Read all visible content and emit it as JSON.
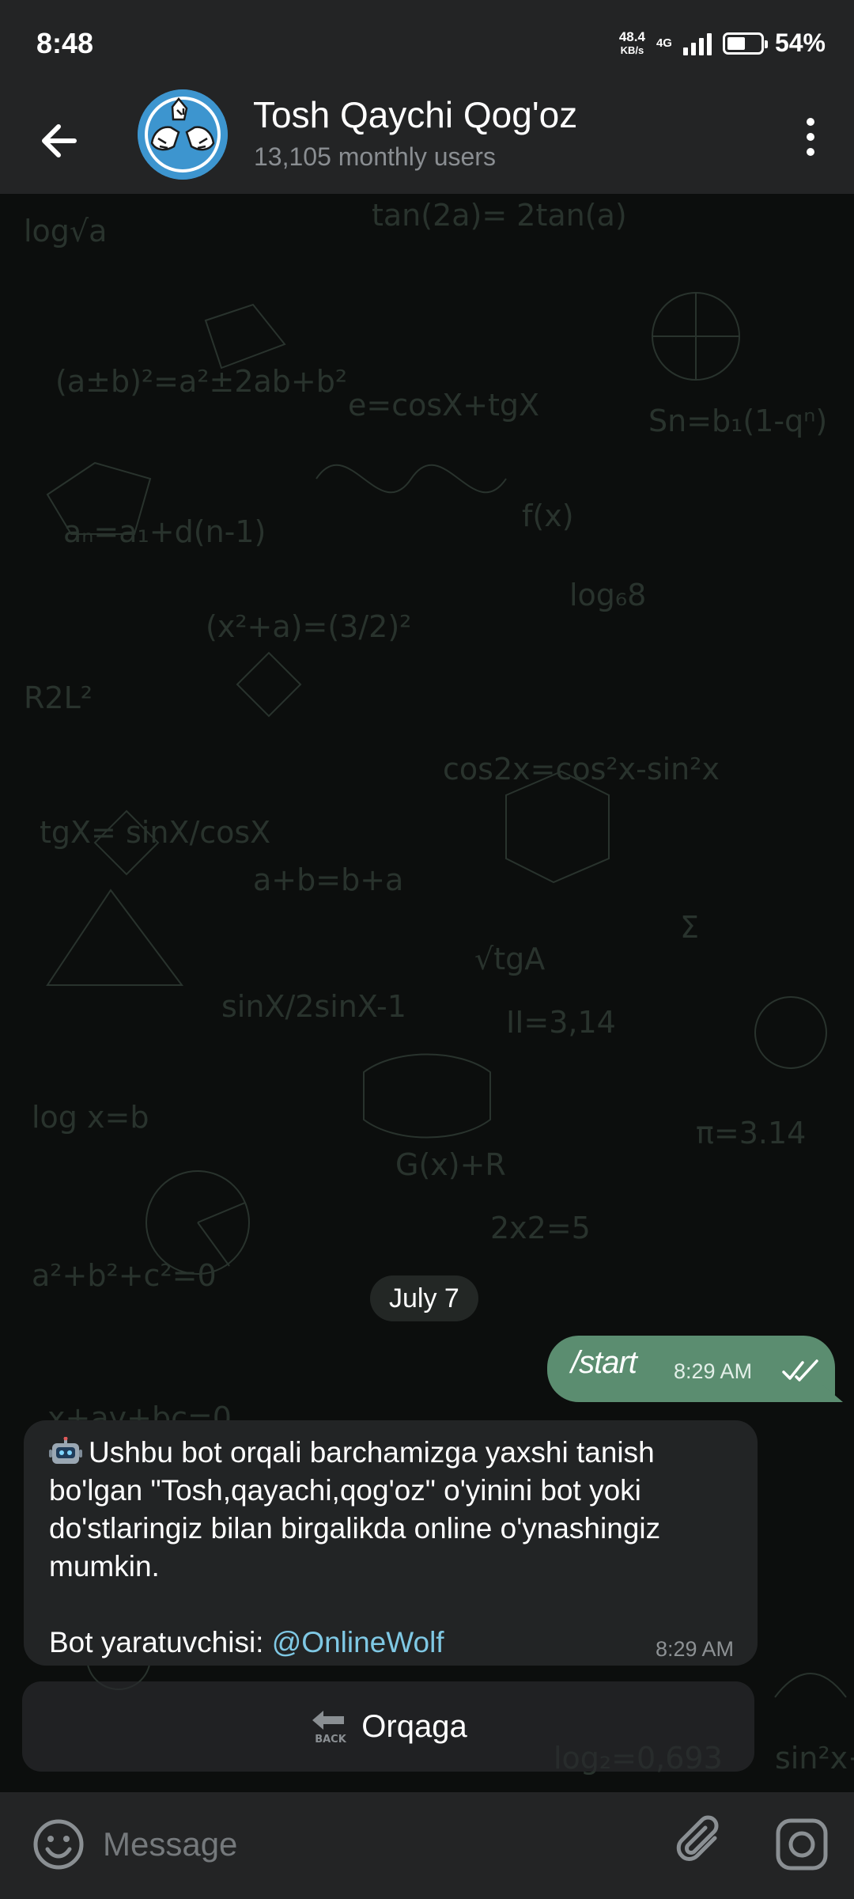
{
  "status_bar": {
    "time": "8:48",
    "net_speed_value": "48.4",
    "net_speed_unit": "KB/s",
    "network_type": "4G",
    "battery_percent": "54%",
    "battery_level": 0.54
  },
  "header": {
    "title": "Tosh Qaychi Qog'oz",
    "subtitle": "13,105 monthly users",
    "back_icon": "arrow-left-icon",
    "menu_icon": "more-vertical-icon",
    "avatar_icon": "rock-scissors-paper-hands-icon"
  },
  "chat": {
    "date_label": "July 7",
    "messages": [
      {
        "direction": "outgoing",
        "text": "/start",
        "time": "8:29 AM",
        "status_icon": "double-check-icon"
      },
      {
        "direction": "incoming",
        "emoji": "robot-icon",
        "text": "Ushbu bot orqali barchamizga yaxshi tanish bo'lgan \"Tosh,qayachi,qog'oz\" o'yinini bot yoki do'stlaringiz bilan birgalikda online o'ynashingiz mumkin.",
        "creator_label": "Bot yaratuvchisi:",
        "creator_link": "@OnlineWolf",
        "time": "8:29 AM"
      }
    ],
    "inline_button": {
      "icon": "back-arrow-icon",
      "icon_caption": "BACK",
      "label": "Orqaga"
    }
  },
  "input_bar": {
    "placeholder": "Message",
    "emoji_icon": "smile-icon",
    "attach_icon": "paperclip-icon",
    "camera_icon": "instagram-camera-icon"
  },
  "colors": {
    "bar_bg": "#232425",
    "outgoing_bubble": "#5b8d70",
    "incoming_bubble": "#222425",
    "link": "#7fc8e4",
    "muted_text": "#8a8e92"
  }
}
